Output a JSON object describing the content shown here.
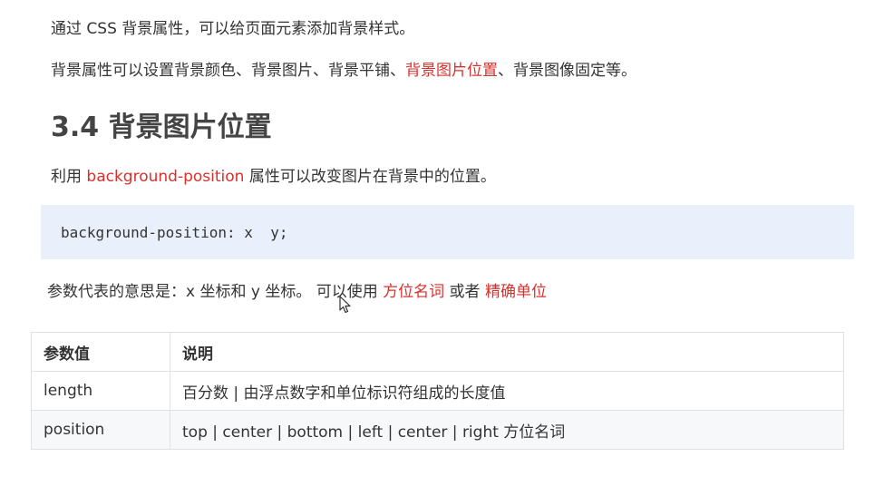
{
  "intro": {
    "line1": "通过 CSS 背景属性，可以给页面元素添加背景样式。",
    "line2_prefix": "背景属性可以设置背景颜色、背景图片、背景平铺、",
    "line2_highlight": "背景图片位置",
    "line2_suffix": "、背景图像固定等。"
  },
  "section": {
    "heading": "3.4 背景图片位置",
    "desc_prefix": "利用 ",
    "desc_highlight": "background-position",
    "desc_suffix": " 属性可以改变图片在背景中的位置。"
  },
  "code": {
    "snippet": "background-position: x  y;"
  },
  "params_note": {
    "prefix": "参数代表的意思是：x 坐标和 y 坐标。 可以使用 ",
    "highlight1": "方位名词",
    "middle": " 或者 ",
    "highlight2": "精确单位"
  },
  "table": {
    "headers": [
      "参数值",
      "说明"
    ],
    "rows": [
      [
        "length",
        "百分数 | 由浮点数字和单位标识符组成的长度值"
      ],
      [
        "position",
        "top | center | bottom | left | center | right   方位名词"
      ]
    ]
  },
  "colors": {
    "highlight_red": "#d9302c",
    "code_bg": "#e9f0fb",
    "heading": "#444444",
    "text": "#333333"
  },
  "icons": {
    "cursor": "mouse-pointer-icon"
  }
}
